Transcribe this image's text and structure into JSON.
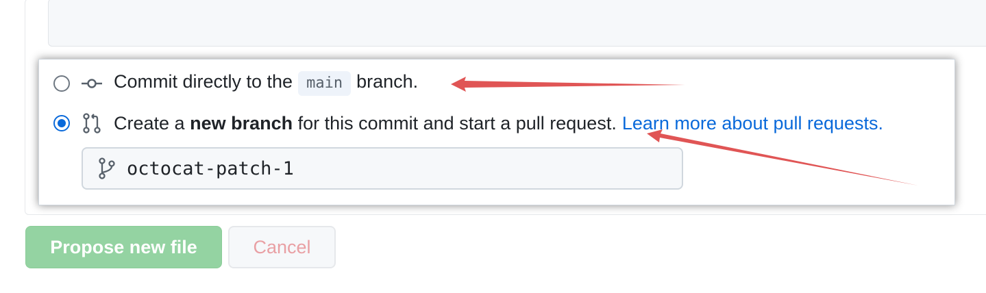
{
  "commit_choice": {
    "direct": {
      "text_before": "Commit directly to the",
      "branch": "main",
      "text_after": "branch.",
      "selected": false,
      "icon": "git-commit-icon"
    },
    "new_branch": {
      "text_before": "Create a",
      "text_bold": "new branch",
      "text_after": "for this commit and start a pull request.",
      "link": "Learn more about pull requests.",
      "selected": true,
      "icon": "git-pull-request-icon"
    },
    "branch_name": {
      "value": "octocat-patch-1",
      "icon": "git-branch-icon"
    }
  },
  "buttons": {
    "propose": "Propose new file",
    "cancel": "Cancel"
  },
  "colors": {
    "accent": "#0969da",
    "primary_disabled": "#94d3a2",
    "cancel_text": "#e9a0a4",
    "annotation_arrow": "#e05555"
  }
}
